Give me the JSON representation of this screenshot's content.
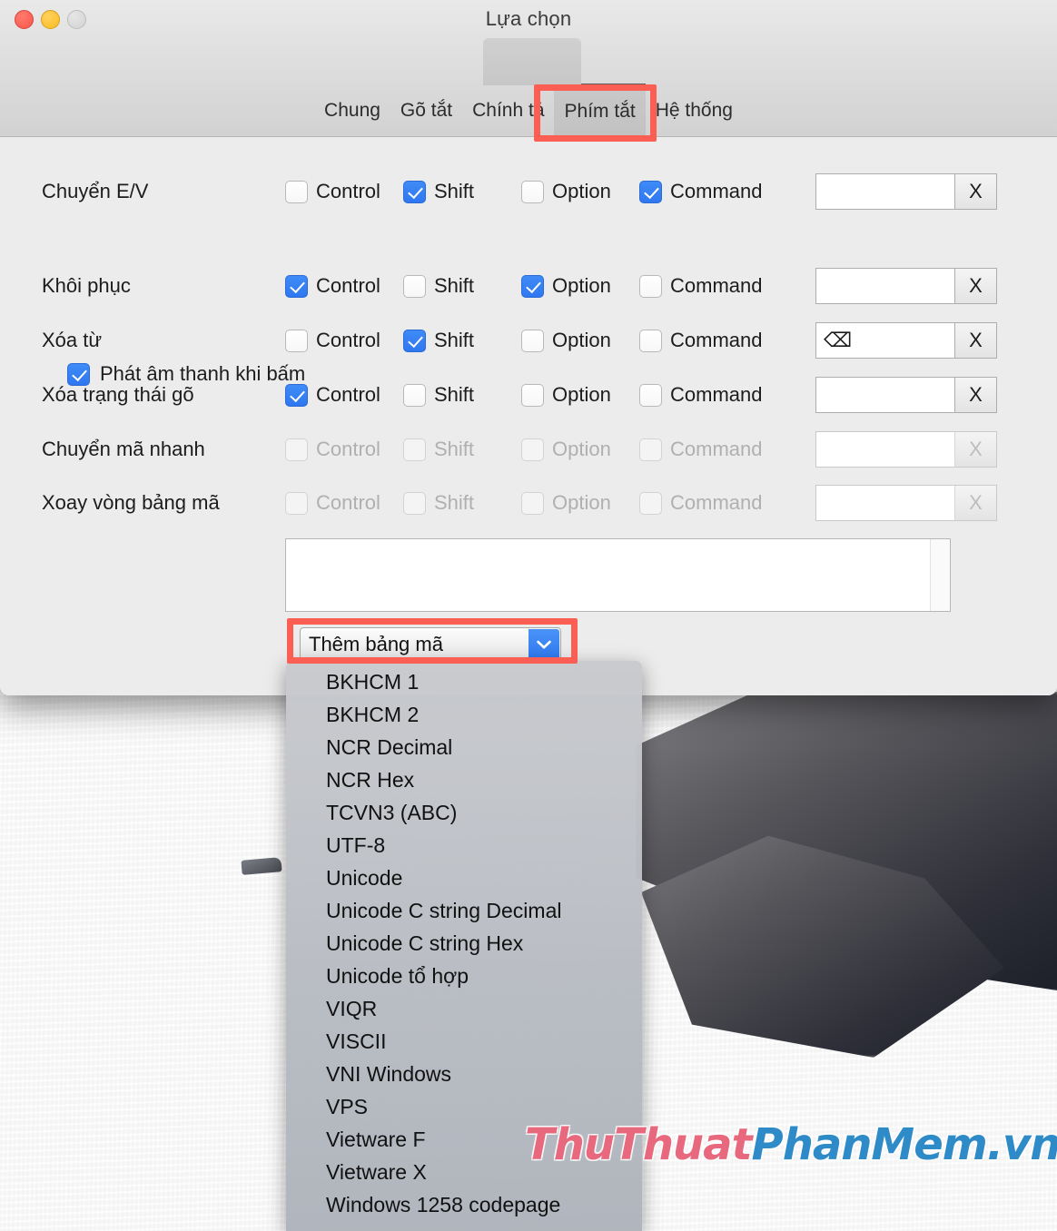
{
  "window": {
    "title": "Lựa chọn",
    "traffic_lights": [
      "close-red",
      "minimize-yellow",
      "zoom-gray-disabled"
    ]
  },
  "toolbar": {
    "tabs": [
      {
        "label": "Chung",
        "selected": false
      },
      {
        "label": "Gõ tắt",
        "selected": false
      },
      {
        "label": "Chính tả",
        "selected": false
      },
      {
        "label": "Phím tắt",
        "selected": true
      },
      {
        "label": "Hệ thống",
        "selected": false
      }
    ]
  },
  "modifier_headers": [
    "Control",
    "Shift",
    "Option",
    "Command"
  ],
  "shortcut_rows": [
    {
      "label": "Chuyển E/V",
      "control": true,
      "shift": true,
      "option": false,
      "command": true,
      "key": "",
      "clear_label": "X",
      "enabled": true
    },
    {
      "label": "Khôi phục",
      "control": true,
      "shift": false,
      "option": true,
      "command": false,
      "key": "",
      "clear_label": "X",
      "enabled": true
    },
    {
      "label": "Xóa từ",
      "control": false,
      "shift": true,
      "option": false,
      "command": false,
      "key": "⌫",
      "clear_label": "X",
      "enabled": true
    },
    {
      "label": "Xóa trạng thái gõ",
      "control": true,
      "shift": false,
      "option": false,
      "command": false,
      "key": "",
      "clear_label": "X",
      "enabled": true
    },
    {
      "label": "Chuyển mã nhanh",
      "control": false,
      "shift": false,
      "option": false,
      "command": false,
      "key": "",
      "clear_label": "X",
      "enabled": false
    },
    {
      "label": "Xoay vòng bảng mã",
      "control": false,
      "shift": false,
      "option": false,
      "command": false,
      "key": "",
      "clear_label": "X",
      "enabled": false
    }
  ],
  "sound_option": {
    "label": "Phát âm thanh khi bấm",
    "checked": true
  },
  "codepage_list": {
    "items": [],
    "empty": true
  },
  "popup_button": {
    "label": "Thêm bảng mã",
    "arrow_icon": "chevron-down-icon"
  },
  "dropdown_menu": {
    "open": true,
    "items": [
      "BKHCM 1",
      "BKHCM 2",
      "NCR Decimal",
      "NCR Hex",
      "TCVN3 (ABC)",
      "UTF-8",
      "Unicode",
      "Unicode C string Decimal",
      "Unicode C string Hex",
      "Unicode tổ hợp",
      "VIQR",
      "VISCII",
      "VNI Windows",
      "VPS",
      "Vietware F",
      "Vietware X",
      "Windows 1258 codepage"
    ]
  },
  "annotations": {
    "tab_highlight_color": "#fb5e52",
    "popup_highlight_color": "#fb5e52"
  },
  "watermark": {
    "part1": "ThuThuat",
    "part2": "PhanMem.vn",
    "color1": "#e8697d",
    "color2": "#2e8bc8"
  }
}
